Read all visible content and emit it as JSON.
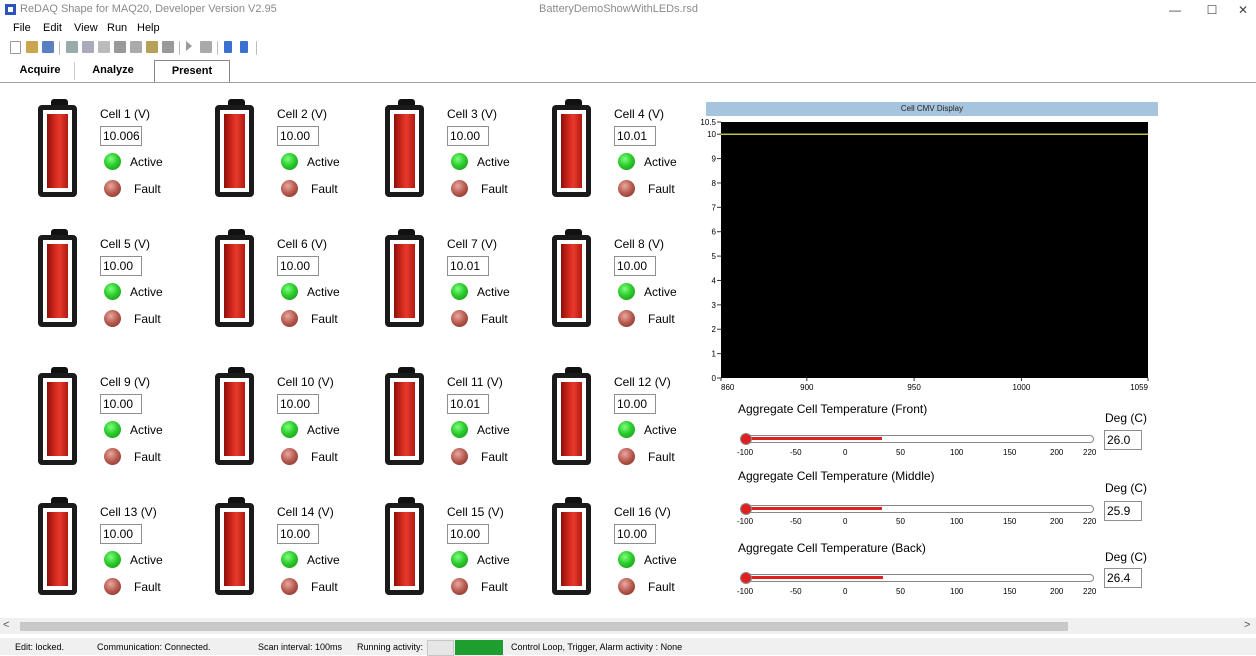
{
  "window": {
    "app_title": "ReDAQ Shape for MAQ20, Developer Version  V2.95",
    "doc_title": "BatteryDemoShowWithLEDs.rsd",
    "minimize": "—",
    "maximize": "☐",
    "close": "✕"
  },
  "menu": [
    "File",
    "Edit",
    "View",
    "Run",
    "Help"
  ],
  "tabs": [
    "Acquire",
    "Analyze",
    "Present"
  ],
  "cells": [
    {
      "label": "Cell 1 (V)",
      "value": "10.006"
    },
    {
      "label": "Cell 2 (V)",
      "value": "10.00"
    },
    {
      "label": "Cell 3 (V)",
      "value": "10.00"
    },
    {
      "label": "Cell 4 (V)",
      "value": "10.01"
    },
    {
      "label": "Cell 5 (V)",
      "value": "10.00"
    },
    {
      "label": "Cell 6 (V)",
      "value": "10.00"
    },
    {
      "label": "Cell 7 (V)",
      "value": "10.01"
    },
    {
      "label": "Cell 8 (V)",
      "value": "10.00"
    },
    {
      "label": "Cell 9 (V)",
      "value": "10.00"
    },
    {
      "label": "Cell 10 (V)",
      "value": "10.00"
    },
    {
      "label": "Cell 11 (V)",
      "value": "10.01"
    },
    {
      "label": "Cell 12 (V)",
      "value": "10.00"
    },
    {
      "label": "Cell 13 (V)",
      "value": "10.00"
    },
    {
      "label": "Cell 14 (V)",
      "value": "10.00"
    },
    {
      "label": "Cell 15 (V)",
      "value": "10.00"
    },
    {
      "label": "Cell 16 (V)",
      "value": "10.00"
    }
  ],
  "led_labels": {
    "active": "Active",
    "fault": "Fault"
  },
  "chart_data": {
    "type": "line",
    "title": "Cell CMV Display",
    "x": [
      860,
      1059
    ],
    "y": [
      10,
      10
    ],
    "xlim": [
      860,
      1059
    ],
    "ylim": [
      0,
      10.5
    ],
    "xticks": [
      "860",
      "900",
      "950",
      "1000",
      "1059"
    ],
    "yticks": [
      "0",
      "1",
      "2",
      "3",
      "4",
      "5",
      "6",
      "7",
      "8",
      "9",
      "10",
      "10.5"
    ],
    "background": "#000000",
    "line_color": "#ffff66"
  },
  "temperatures": [
    {
      "title": "Aggregate Cell Temperature (Front)",
      "unit": "Deg (C)",
      "value": "26.0"
    },
    {
      "title": "Aggregate Cell Temperature (Middle)",
      "unit": "Deg (C)",
      "value": "25.9"
    },
    {
      "title": "Aggregate Cell Temperature (Back)",
      "unit": "Deg (C)",
      "value": "26.4"
    }
  ],
  "thermo_scale": {
    "min": -100,
    "max": 220,
    "ticks": [
      "-100",
      "-50",
      "0",
      "50",
      "100",
      "150",
      "200",
      "220"
    ]
  },
  "status": {
    "edit": "Edit: locked.",
    "communication": "Communication: Connected.",
    "scan": "Scan interval: 100ms",
    "running": "Running activity:",
    "control": "Control Loop, Trigger, Alarm activity : None"
  },
  "scroll": {
    "left": "<",
    "right": ">"
  }
}
